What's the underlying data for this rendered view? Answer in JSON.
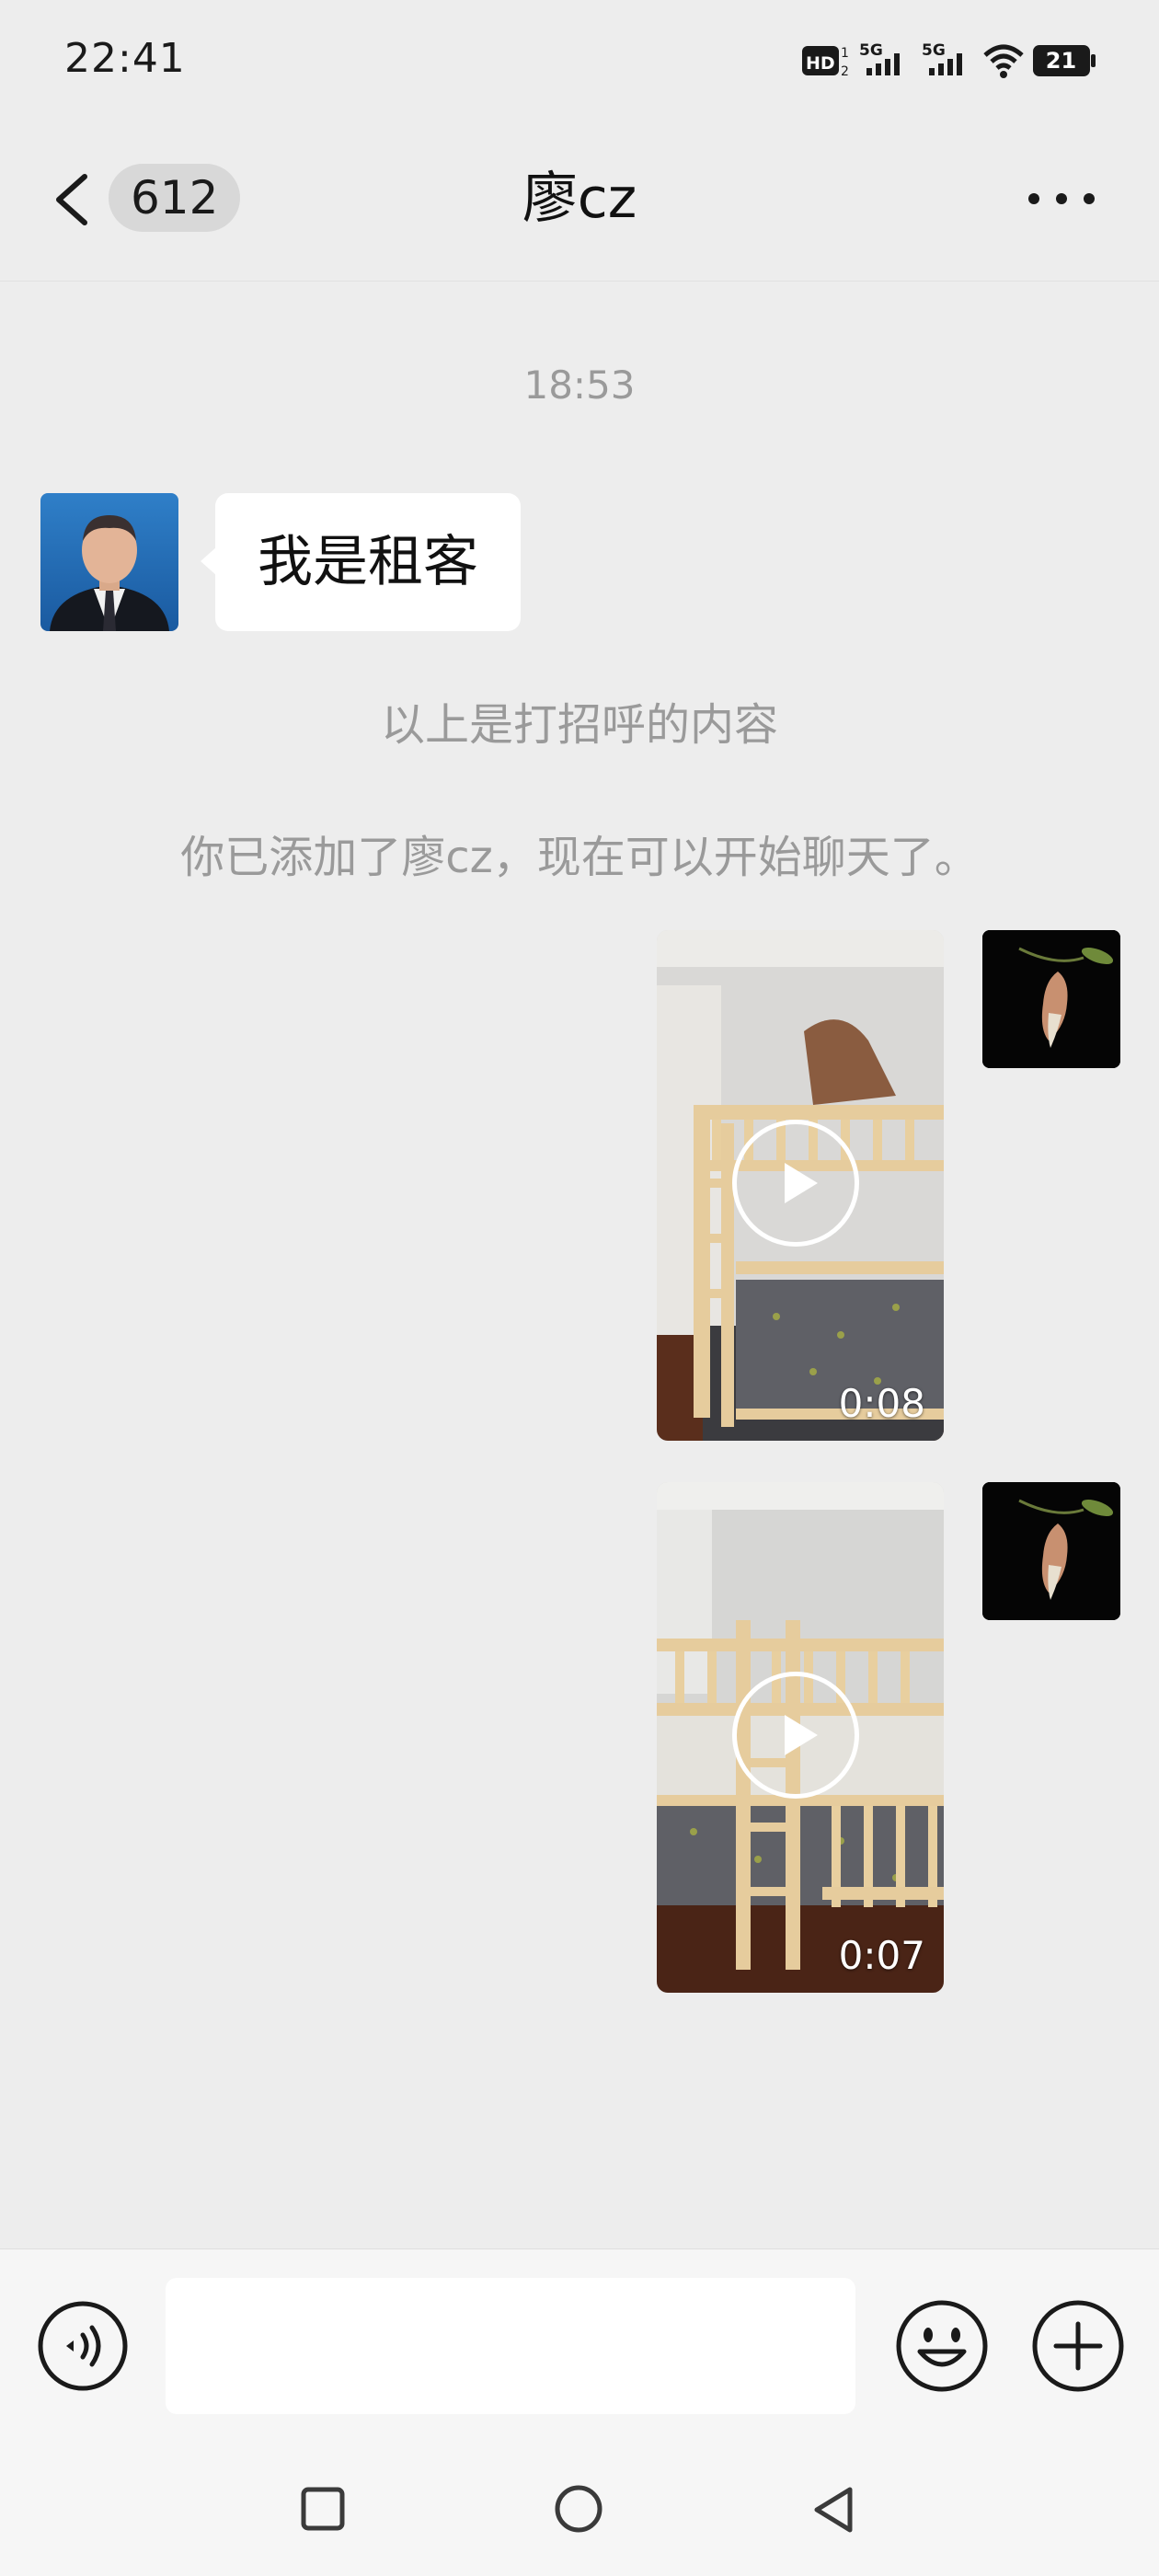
{
  "status_bar": {
    "time": "22:41",
    "battery_level": "21",
    "icons": [
      "hd-voice-icon",
      "signal-5g-icon",
      "signal-5g-icon",
      "wifi-icon",
      "battery-icon"
    ]
  },
  "header": {
    "unread_count": "612",
    "title": "廖cz",
    "back_icon": "chevron-left-icon",
    "more_icon": "more-dots-icon"
  },
  "messages": {
    "timestamp": "18:53",
    "greeting_text": "我是租客",
    "greeting_note": "以上是打招呼的内容",
    "added_note": "你已添加了廖cz，现在可以开始聊天了。",
    "videos": [
      {
        "duration": "0:08"
      },
      {
        "duration": "0:07"
      }
    ]
  },
  "input_bar": {
    "voice_icon": "voice-icon",
    "message_value": "",
    "emoji_icon": "emoji-icon",
    "plus_icon": "plus-circle-icon"
  },
  "nav_bar": {
    "icons": [
      "recents-square-icon",
      "home-circle-icon",
      "back-triangle-icon"
    ]
  },
  "colors": {
    "background": "#ededed",
    "bubble_in": "#ffffff",
    "system_text": "#9a9a9a",
    "bar_background": "#f6f6f6"
  }
}
